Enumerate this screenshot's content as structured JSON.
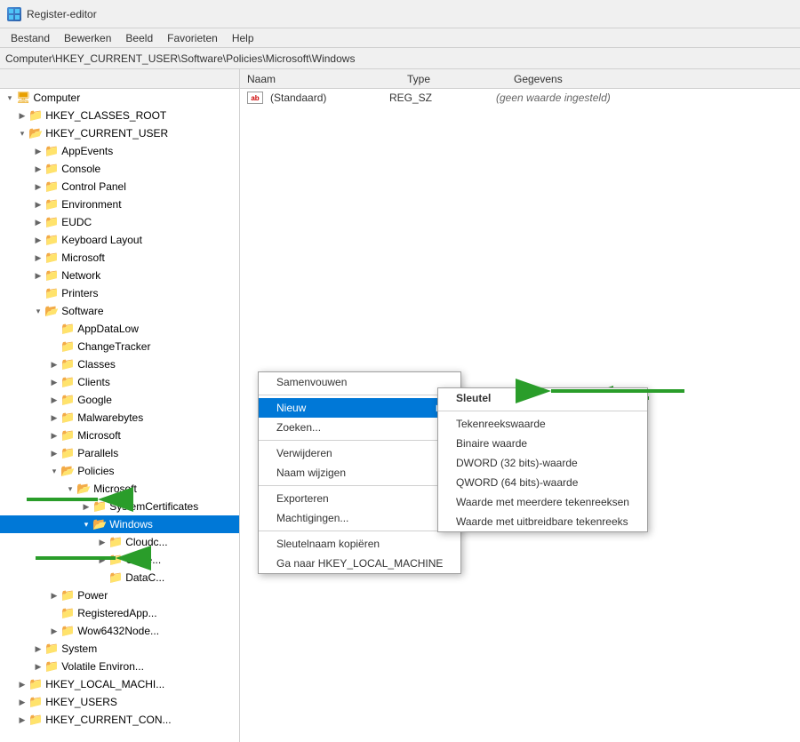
{
  "window": {
    "title": "Register-editor",
    "icon": "RE"
  },
  "menubar": {
    "items": [
      "Bestand",
      "Bewerken",
      "Beeld",
      "Favorieten",
      "Help"
    ]
  },
  "addressbar": {
    "path": "Computer\\HKEY_CURRENT_USER\\Software\\Policies\\Microsoft\\Windows"
  },
  "columns": {
    "name_header": "Naam",
    "type_header": "Type",
    "data_header": "Gegevens"
  },
  "detail_row": {
    "icon": "ab",
    "name": "(Standaard)",
    "type": "REG_SZ",
    "data": "(geen waarde ingesteld)"
  },
  "tree": {
    "computer_label": "Computer",
    "hkey_classes_root": "HKEY_CLASSES_ROOT",
    "hkey_current_user": "HKEY_CURRENT_USER",
    "app_events": "AppEvents",
    "console": "Console",
    "control_panel": "Control Panel",
    "environment": "Environment",
    "eudc": "EUDC",
    "keyboard_layout": "Keyboard Layout",
    "microsoft": "Microsoft",
    "network": "Network",
    "printers": "Printers",
    "software": "Software",
    "app_data_low": "AppDataLow",
    "change_tracker": "ChangeTracker",
    "classes": "Classes",
    "clients": "Clients",
    "google": "Google",
    "malwarebytes": "Malwarebytes",
    "microsoft2": "Microsoft",
    "parallels": "Parallels",
    "policies": "Policies",
    "policies_microsoft": "Microsoft",
    "system_certificates": "SystemCertificates",
    "windows": "Windows",
    "cloudc": "Cloudc...",
    "curre": "Curre...",
    "datac": "DataC...",
    "power": "Power",
    "registered_app": "RegisteredApp...",
    "wow6432node": "Wow6432Node...",
    "system": "System",
    "volatile_environ": "Volatile Environ...",
    "hkey_local_machi": "HKEY_LOCAL_MACHI...",
    "hkey_users": "HKEY_USERS",
    "hkey_current_con": "HKEY_CURRENT_CON..."
  },
  "context_menu1": {
    "items": [
      {
        "label": "Samenvouwen",
        "id": "samenvouwen",
        "has_submenu": false
      },
      {
        "label": "Nieuw",
        "id": "nieuw",
        "has_submenu": true,
        "highlighted": true
      },
      {
        "label": "Zoeken...",
        "id": "zoeken",
        "has_submenu": false
      },
      {
        "label": "Verwijderen",
        "id": "verwijderen",
        "has_submenu": false
      },
      {
        "label": "Naam wijzigen",
        "id": "naam_wijzigen",
        "has_submenu": false
      },
      {
        "label": "Exporteren",
        "id": "exporteren",
        "has_submenu": false
      },
      {
        "label": "Machtigingen...",
        "id": "machtigingen",
        "has_submenu": false
      },
      {
        "label": "Sleutelnaam kopiëren",
        "id": "sleutelnaam",
        "has_submenu": false
      },
      {
        "label": "Ga naar HKEY_LOCAL_MACHINE",
        "id": "ga_naar",
        "has_submenu": false
      }
    ]
  },
  "context_menu2": {
    "items": [
      {
        "label": "Sleutel",
        "id": "sleutel",
        "bold": true
      },
      {
        "label": "Tekenreekswaarde",
        "id": "tekenreeks"
      },
      {
        "label": "Binaire waarde",
        "id": "binaire"
      },
      {
        "label": "DWORD (32 bits)-waarde",
        "id": "dword"
      },
      {
        "label": "QWORD (64 bits)-waarde",
        "id": "qword"
      },
      {
        "label": "Waarde met meerdere tekenreeksen",
        "id": "multi"
      },
      {
        "label": "Waarde met uitbreidbare tekenreeks",
        "id": "expand"
      }
    ]
  },
  "arrows": {
    "arrow1_label": "green arrow pointing to Windows",
    "arrow2_label": "green arrow pointing to Nieuw",
    "arrow3_label": "green arrow pointing to Sleutel"
  }
}
